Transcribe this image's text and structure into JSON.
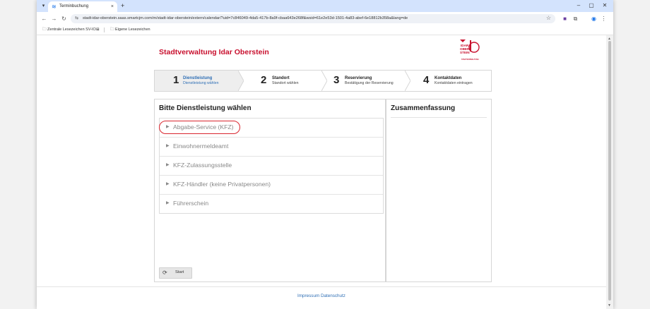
{
  "browser": {
    "tab_title": "Terminbuchung",
    "tab_close": "×",
    "new_tab": "+",
    "url": "stadt-idar-oberstein.saas.smartcjm.com/m/stadt-idar-oberstein/extern/calendar/?uid=7c846049-4da5-417b-8a9f-cbaa643e268f&wsid=61e2e53d-1501-4a83-abef-6e18812b358a&lang=de",
    "bookmarks": [
      "Zentrale Lesezeichen SV-IO",
      "Eigene Lesezeichen"
    ],
    "window_controls": [
      "–",
      "▢",
      "✕"
    ],
    "icons": {
      "tab_list": "chevron-down-icon",
      "back": "back-arrow-icon",
      "forward": "forward-arrow-icon",
      "reload": "reload-icon",
      "site_info": "site-info-icon",
      "bookmark_star": "star-icon",
      "extensions": "puzzle-icon",
      "profile": "profile-icon",
      "menu": "kebab-menu-icon"
    }
  },
  "header": {
    "org_title": "Stadtverwaltung Idar Oberstein",
    "logo_lines": [
      "IDAR",
      "OBER",
      "STEIN"
    ],
    "logo_caption": "STADTVERWALTUNG",
    "brand_color": "#c8102e"
  },
  "steps": [
    {
      "number": "1",
      "title": "Dienstleistung",
      "subtitle": "Dienstleistung wählen",
      "active": true
    },
    {
      "number": "2",
      "title": "Standort",
      "subtitle": "Standort wählen",
      "active": false
    },
    {
      "number": "3",
      "title": "Reservierung",
      "subtitle": "Bestätigung der Reservierung",
      "active": false
    },
    {
      "number": "4",
      "title": "Kontaktdaten",
      "subtitle": "Kontaktdaten eintragen",
      "active": false
    }
  ],
  "services": {
    "heading": "Bitte Dienstleistung wählen",
    "items": [
      "Abgabe-Service (KFZ)",
      "Einwohnermeldeamt",
      "KFZ-Zulassungsstelle",
      "KFZ-Händler (keine Privatpersonen)",
      "Führerschein"
    ],
    "highlighted_item": "Abgabe-Service (KFZ)",
    "highlight_color": "#d9252e",
    "start_label": "Start"
  },
  "summary": {
    "heading": "Zusammenfassung"
  },
  "footer": {
    "impressum": "Impressum",
    "datenschutz": "Datenschutz"
  },
  "colors": {
    "link_blue": "#2f6fb5",
    "tab_strip": "#d3e3fd"
  }
}
